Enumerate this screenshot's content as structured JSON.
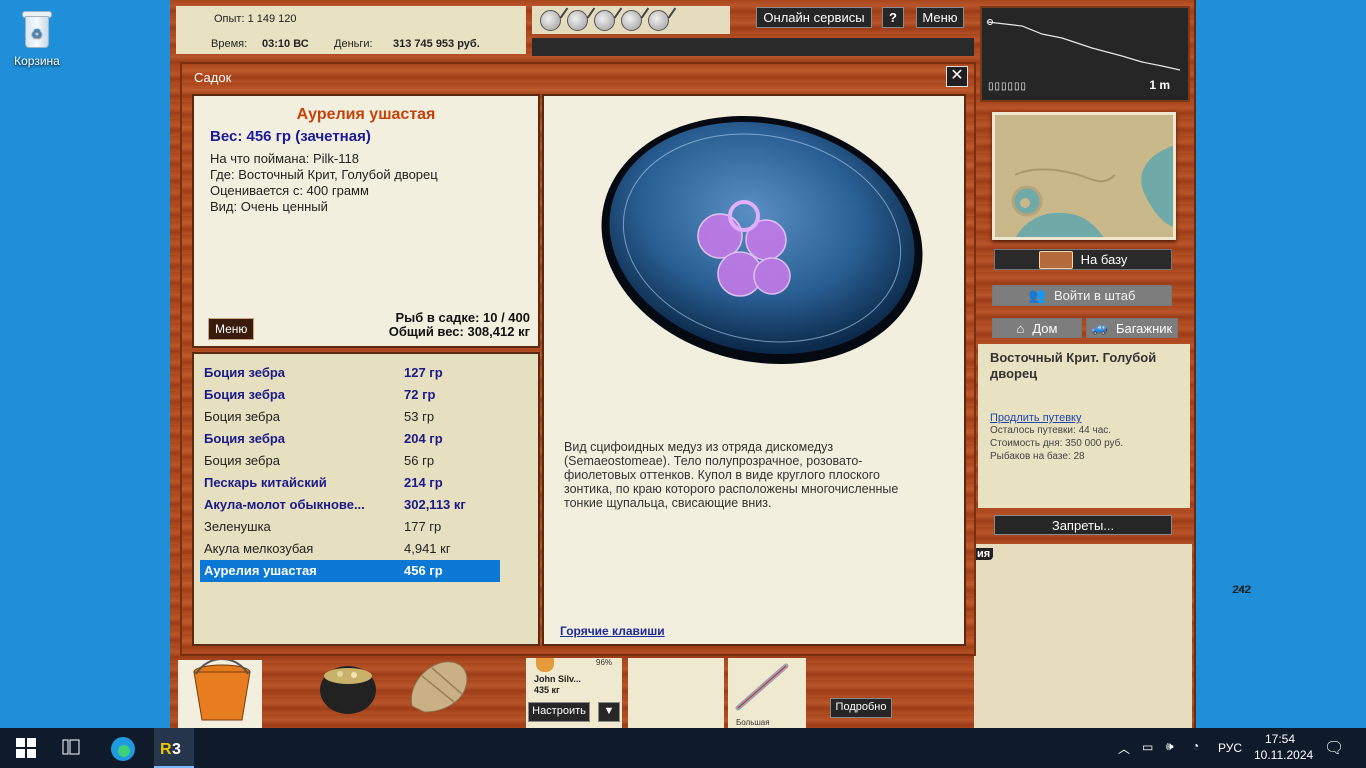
{
  "desktop": {
    "recycle_bin_label": "Корзина"
  },
  "top": {
    "experience_label": "Опыт:",
    "experience_value": "1 149 120",
    "time_label": "Время:",
    "time_value": "03:10 ВС",
    "money_label": "Деньги:",
    "money_value": "313 745 953 руб.",
    "online_services": "Онлайн сервисы",
    "help": "?",
    "menu": "Меню"
  },
  "depth": {
    "value": "1 m",
    "bars": "▯▯▯▯▯▯"
  },
  "right": {
    "to_base": "На базу",
    "to_hq": "Войти в штаб",
    "home": "Дом",
    "trunk": "Багажник",
    "location_title": "Восточный Крит. Голубой дворец",
    "extend_trip": "Продлить путевку",
    "trip_left": "Осталось путевки: 44 час.",
    "day_cost": "Стоимость дня: 350 000 руб.",
    "anglers": "Рыбаков на базе: 28",
    "bans": "Запреты...",
    "tab_fragment": "ия",
    "lower_number": "242",
    "details": "Подробно"
  },
  "dialog": {
    "title": "Садок",
    "fish_name": "Аурелия ушастая",
    "weight_line": "Вес: 456 гр (зачетная)",
    "bait_line": "На что поймана: Pilk-118",
    "where_line": "Где: Восточный Крит, Голубой дворец",
    "rated_line": "Оценивается с: 400 грамм",
    "kind_line": "Вид: Очень ценный",
    "menu_btn": "Меню",
    "fish_in_keepnet": "Рыб в садке: 10 / 400",
    "total_weight": "Общий вес: 308,412 кг",
    "description": "Вид сцифоидных медуз из отряда дискомедуз (Semaeostomeae). Тело полупрозрачное, розовато-фиолетовых оттенков. Купол в виде круглого плоского зонтика, по краю которого расположены многочисленные тонкие щупальца, свисающие вниз.",
    "hotkeys": "Горячие клавиши",
    "catch_list": [
      {
        "name": "Боция зебра",
        "weight": "127 гр",
        "bold": true
      },
      {
        "name": "Боция зебра",
        "weight": "72 гр",
        "bold": true
      },
      {
        "name": "Боция зебра",
        "weight": "53 гр",
        "bold": false
      },
      {
        "name": "Боция зебра",
        "weight": "204 гр",
        "bold": true
      },
      {
        "name": "Боция зебра",
        "weight": "56 гр",
        "bold": false
      },
      {
        "name": "Пескарь китайский",
        "weight": "214 гр",
        "bold": true
      },
      {
        "name": "Акула-молот обыкнове...",
        "weight": "302,113 кг",
        "bold": true
      },
      {
        "name": "Зеленушка",
        "weight": "177 гр",
        "bold": false
      },
      {
        "name": "Акула мелкозубая",
        "weight": "4,941 кг",
        "bold": false
      },
      {
        "name": "Аурелия ушастая",
        "weight": "456 гр",
        "bold": true,
        "selected": true
      }
    ]
  },
  "bottom": {
    "angler_name": "John Silv...",
    "angler_weight": "435 кг",
    "angler_percent": "96%",
    "setup_btn": "Настроить",
    "setup_arrow": "▼",
    "lure_label": "Большая"
  },
  "taskbar": {
    "lang": "РУС",
    "time": "17:54",
    "date": "10.11.2024"
  }
}
